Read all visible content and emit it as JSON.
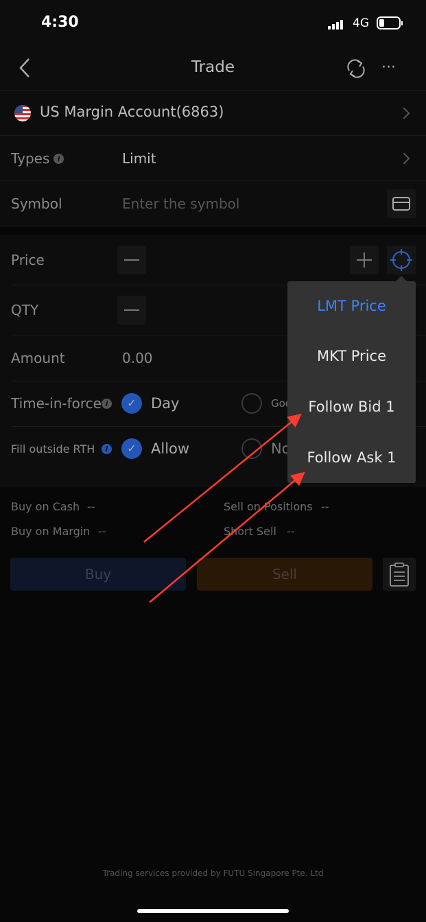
{
  "status_bar": {
    "time": "4:30",
    "network": "4G"
  },
  "header": {
    "title": "Trade",
    "icons": [
      "back-icon",
      "refresh-icon",
      "more-icon"
    ]
  },
  "account": {
    "name": "US Margin Account(6863)",
    "flag": "us-flag-icon"
  },
  "form": {
    "types": {
      "label": "Types",
      "value": "Limit"
    },
    "symbol": {
      "label": "Symbol",
      "placeholder": "Enter the symbol"
    },
    "price": {
      "label": "Price"
    },
    "qty": {
      "label": "QTY"
    },
    "amount": {
      "label": "Amount",
      "value": "0.00"
    },
    "time_in_force": {
      "label": "Time-in-force",
      "option1": "Day",
      "option2": "Goo"
    },
    "fill_outside_rth": {
      "label": "Fill outside RTH",
      "option1": "Allow",
      "option2": "No"
    }
  },
  "price_menu": {
    "items": [
      {
        "label": "LMT Price",
        "selected": true
      },
      {
        "label": "MKT Price"
      },
      {
        "label": "Follow Bid 1"
      },
      {
        "label": "Follow Ask 1"
      }
    ]
  },
  "buying_power": {
    "buy_on_cash": "Buy on Cash",
    "buy_on_cash_value": "--",
    "buy_on_margin": "Buy on Margin",
    "buy_on_margin_value": "--",
    "sell_on_positions": "Sell on Positions",
    "sell_on_positions_value": "--",
    "short_sell": "Short Sell",
    "short_sell_value": "--"
  },
  "actions": {
    "buy": "Buy",
    "sell": "Sell"
  },
  "footer": "Trading services provided by FUTU Singapore Pte. Ltd",
  "colors": {
    "accent": "#3b82f6",
    "annotation_arrow": "#ff3b30",
    "buy": "#0e1729",
    "sell": "#2a1806"
  }
}
